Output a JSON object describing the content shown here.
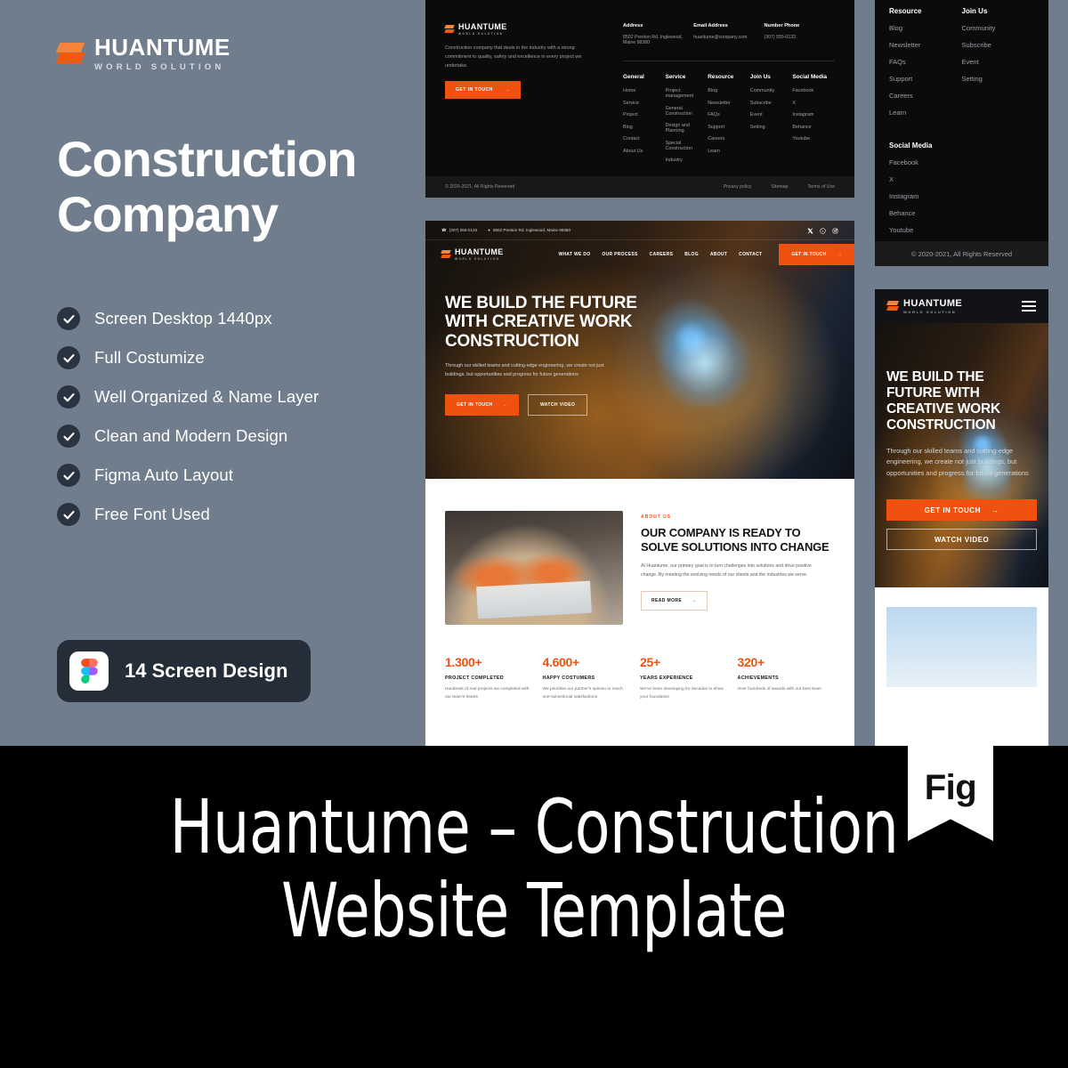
{
  "brand": {
    "name": "HUANTUME",
    "tagline": "WORLD SOLUTION"
  },
  "left_panel": {
    "headline": "Construction Company",
    "features": [
      "Screen Desktop 1440px",
      "Full Costumize",
      "Well Organized & Name Layer",
      "Clean and Modern Design",
      "Figma Auto Layout",
      "Free Font Used"
    ],
    "figma_badge": "14 Screen Design"
  },
  "colors": {
    "background": "#6f7d8c",
    "accent_orange": "#f0510f",
    "dark": "#0b0b0b",
    "badge_dark": "#252d39"
  },
  "mock_footer": {
    "description": "Construction company that deals in the industry with a strong commitment to quality, safety and excellence in every project we undertake.",
    "cta": "GET IN TOUCH",
    "contacts": [
      {
        "title": "Address",
        "value": "8502 Preston Rd. Inglewood, Maine 98380"
      },
      {
        "title": "Email Address",
        "value": "huantume@company.com"
      },
      {
        "title": "Number Phone",
        "value": "(307) 555-0133"
      }
    ],
    "columns": [
      {
        "heading": "General",
        "links": [
          "Home",
          "Service",
          "Project",
          "Blog",
          "Contact",
          "About Us"
        ]
      },
      {
        "heading": "Service",
        "links": [
          "Project management",
          "General Construction",
          "Design and Planning",
          "Special Construction",
          "Industry"
        ]
      },
      {
        "heading": "Resource",
        "links": [
          "Blog",
          "Newsletter",
          "FAQs",
          "Support",
          "Careers",
          "Learn"
        ]
      },
      {
        "heading": "Join Us",
        "links": [
          "Community",
          "Subscribe",
          "Event",
          "Setting"
        ]
      },
      {
        "heading": "Social Media",
        "links": [
          "Facebook",
          "X",
          "Instagram",
          "Behance",
          "Youtube"
        ]
      }
    ],
    "copyright": "© 2020-2021, All Rights Reserved",
    "legal": [
      "Privacy policy",
      "Sitemap",
      "Terms of Use"
    ]
  },
  "mock_desktop": {
    "topbar": {
      "phone": "(307) 555-0133",
      "address": "8502 Preston Rd. Inglewood, Maine 98380",
      "social": [
        "x-icon",
        "whatsapp-icon",
        "instagram-icon"
      ]
    },
    "nav": {
      "links": [
        "WHAT WE DO",
        "OUR PROCESS",
        "CAREERS",
        "BLOG",
        "ABOUT",
        "CONTACT"
      ],
      "cta": "GET IN TOUCH"
    },
    "hero": {
      "title": "WE BUILD THE FUTURE WITH CREATIVE WORK CONSTRUCTION",
      "subtitle": "Through our skilled teams and cutting-edge engineering, we create not just buildings, but opportunities and progress for future generations",
      "primary_button": "GET IN TOUCH",
      "secondary_button": "WATCH VIDEO"
    },
    "about": {
      "eyebrow": "ABOUT US",
      "title": "OUR COMPANY IS READY TO SOLVE SOLUTIONS INTO CHANGE",
      "paragraph": "At Huantume, our primary goal is to turn challenges into solutions and drive positive change. By meeting the evolving needs of our clients and the industries we serve.",
      "button": "READ MORE"
    },
    "stats": [
      {
        "number": "1.300+",
        "label": "PROJECT COMPLETED",
        "desc": "Hundreds of real projects we completed with our team's hearts"
      },
      {
        "number": "4.600+",
        "label": "HAPPY COSTUMERS",
        "desc": "We prioritise our partner's opinion to reach one-sunvetional satisfactions"
      },
      {
        "number": "25+",
        "label": "YEARS EXPERIENCE",
        "desc": "We've been developing for decades to show your foundation"
      },
      {
        "number": "320+",
        "label": "ACHIEVEMENTS",
        "desc": "Over hundreds of awards with our best team"
      }
    ]
  },
  "mock_mobile_footer": {
    "columns": [
      {
        "heading": "Resource",
        "links": [
          "Blog",
          "Newsletter",
          "FAQs",
          "Support",
          "Careers",
          "Learn"
        ]
      },
      {
        "heading": "Join Us",
        "links": [
          "Community",
          "Subscribe",
          "Event",
          "Setting"
        ]
      }
    ],
    "social_heading": "Social Media",
    "social_links": [
      "Facebook",
      "X",
      "Instagram",
      "Behance",
      "Youtube"
    ],
    "copyright": "© 2020-2021, All Rights Reserved"
  },
  "mock_mobile_hero": {
    "title": "WE BUILD THE FUTURE WITH CREATIVE WORK CONSTRUCTION",
    "subtitle": "Through our skilled teams and cutting-edge engineering, we create not just buildings, but opportunities and progress for future generations",
    "primary_button": "GET IN TOUCH",
    "secondary_button": "WATCH VIDEO"
  },
  "title_band": {
    "line1": "Huantume – Construction",
    "line2": "Website Template",
    "ribbon": "Fig"
  }
}
